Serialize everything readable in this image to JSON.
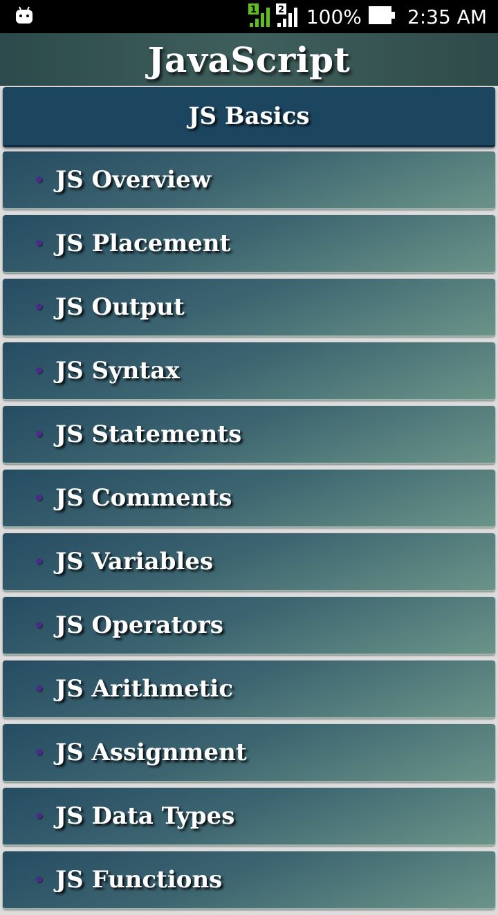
{
  "status_bar": {
    "notification_icon": "android-debug-icon",
    "sim1_label": "1",
    "sim2_label": "2",
    "battery_percent": "100%",
    "time": "2:35 AM",
    "colors": {
      "sim1_signal": "#5fbf1f",
      "sim2_signal": "#ffffff"
    }
  },
  "app_bar": {
    "title": "JavaScript"
  },
  "section": {
    "title": "JS Basics"
  },
  "items": [
    {
      "label": "JS Overview"
    },
    {
      "label": "JS Placement"
    },
    {
      "label": "JS Output"
    },
    {
      "label": "JS Syntax"
    },
    {
      "label": "JS Statements"
    },
    {
      "label": "JS Comments"
    },
    {
      "label": "JS Variables"
    },
    {
      "label": "JS Operators"
    },
    {
      "label": "JS Arithmetic"
    },
    {
      "label": "JS Assignment"
    },
    {
      "label": "JS Data Types"
    },
    {
      "label": "JS Functions"
    }
  ],
  "colors": {
    "section_bg": "#1c4560",
    "bullet": "#4a2c86",
    "item_gradient_start": "#264c62",
    "item_gradient_end": "#6a9488"
  }
}
